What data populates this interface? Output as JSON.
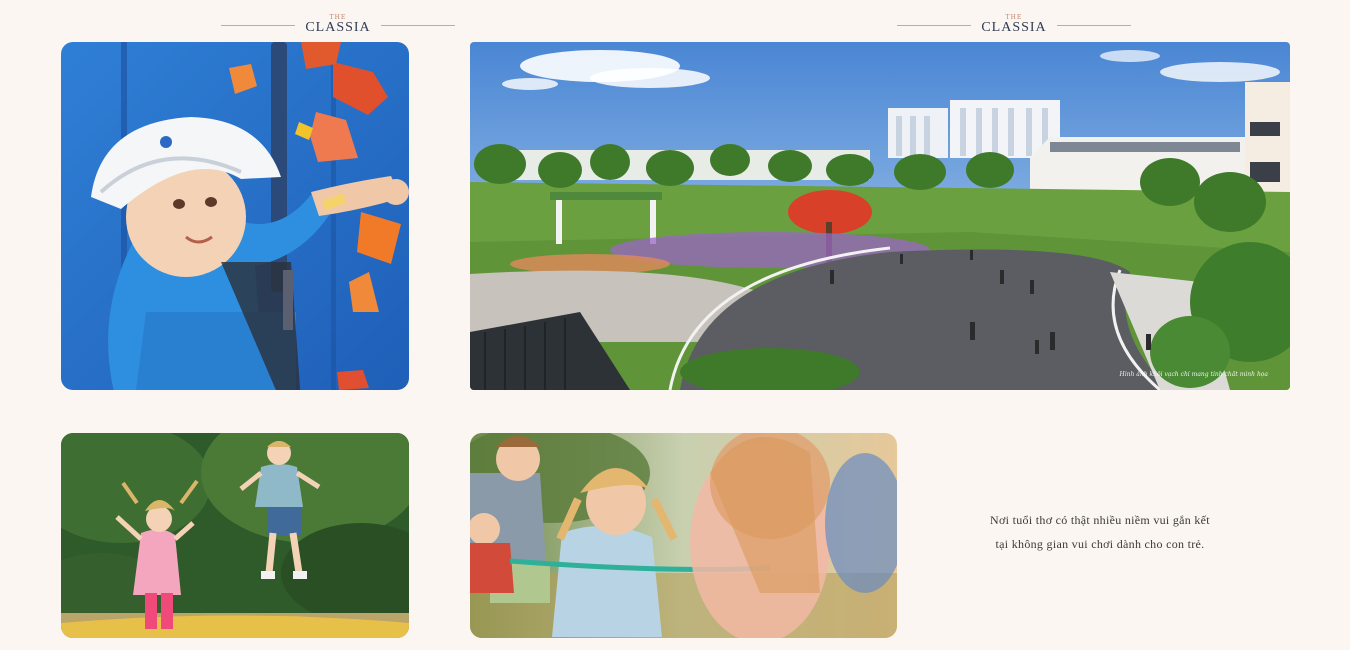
{
  "brand": {
    "prefix": "THE",
    "name": "CLASSIA"
  },
  "gallery": {
    "park": {
      "note": "Hình ảnh khối vạch chỉ mang tính chất minh họa"
    }
  },
  "caption": {
    "line1": "Nơi tuổi thơ có thật nhiều niềm vui gắn kết",
    "line2": "tại không gian vui chơi dành cho con trẻ."
  },
  "colors": {
    "background": "#fbf6f1",
    "brand_navy": "#2f3b55",
    "brand_accent": "#c3826b",
    "caption_text": "#3a3a3a"
  }
}
